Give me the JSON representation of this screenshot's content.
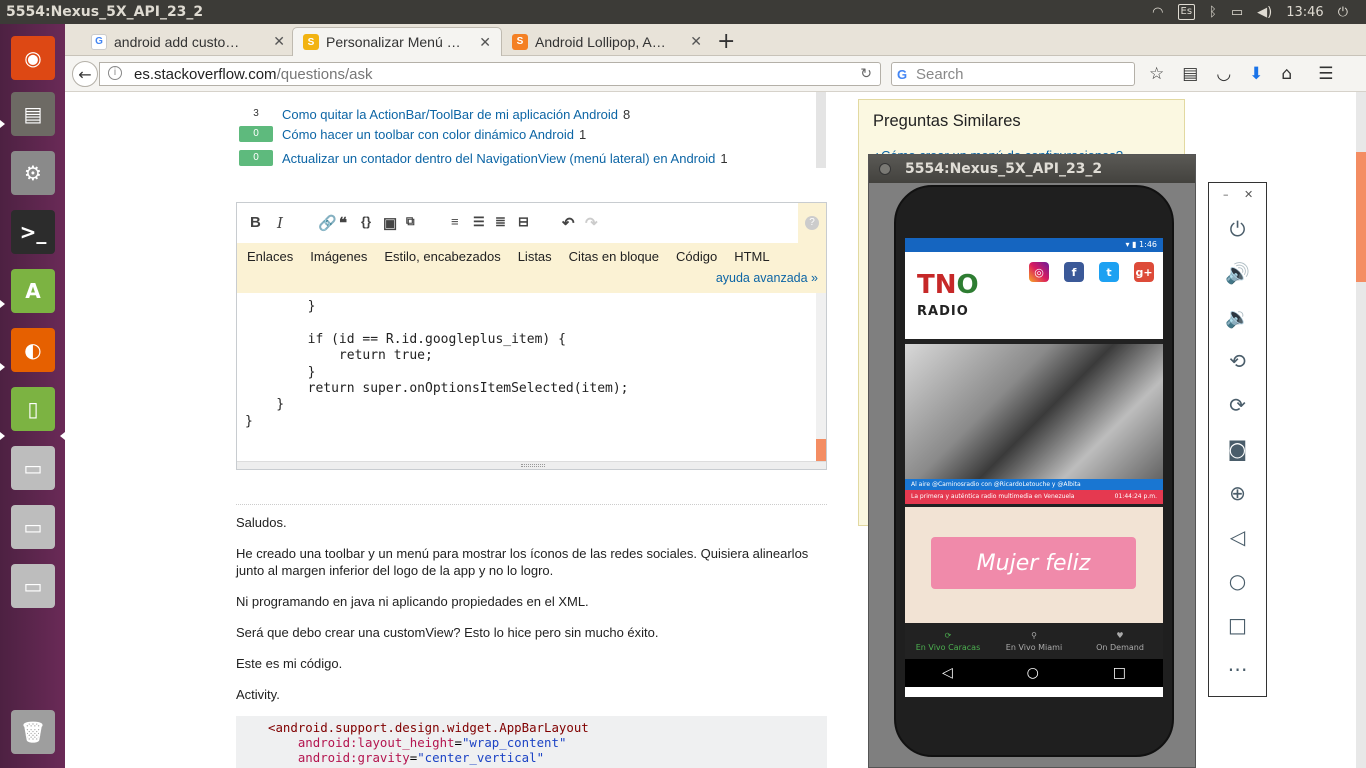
{
  "os": {
    "window_title": "5554:Nexus_5X_API_23_2",
    "keyboard": "Es",
    "time": "13:46"
  },
  "launcher": {
    "items": [
      {
        "name": "ubuntu-dash-icon",
        "color": "#dd4814",
        "glyph": "◉"
      },
      {
        "name": "files-icon",
        "color": "#6d6a64",
        "glyph": "▤"
      },
      {
        "name": "settings-icon",
        "color": "#8a8a8a",
        "glyph": "⚙"
      },
      {
        "name": "terminal-icon",
        "color": "#2c2c2c",
        "glyph": ">_"
      },
      {
        "name": "android-studio-icon",
        "color": "#7cb342",
        "glyph": "A"
      },
      {
        "name": "firefox-icon",
        "color": "#e66000",
        "glyph": "◐"
      },
      {
        "name": "emulator-icon",
        "color": "#7cb342",
        "glyph": "▯"
      },
      {
        "name": "disk-icon",
        "color": "#bdbdbd",
        "glyph": "▭"
      },
      {
        "name": "disk-icon",
        "color": "#bdbdbd",
        "glyph": "▭"
      },
      {
        "name": "disk-icon",
        "color": "#bdbdbd",
        "glyph": "▭"
      },
      {
        "name": "trash-icon",
        "color": "#9e9e9e",
        "glyph": "🗑"
      }
    ]
  },
  "browser": {
    "tabs": [
      {
        "label": "android add custo…",
        "fav": "G",
        "fav_color": "#4285f4"
      },
      {
        "label": "Personalizar Menú …",
        "fav": "S",
        "fav_color": "#f2b311"
      },
      {
        "label": "Android Lollipop, A…",
        "fav": "S",
        "fav_color": "#f48024"
      }
    ],
    "url_host": "es.stackoverflow.com",
    "url_path": "/questions/ask",
    "search_placeholder": "Search"
  },
  "related": [
    {
      "votes": "3",
      "title": "Como quitar la ActionBar/ToolBar de mi aplicación Android",
      "count": "8",
      "accepted": false
    },
    {
      "votes": "0",
      "title": "Cómo hacer un toolbar con color dinámico Android",
      "count": "1",
      "accepted": true
    },
    {
      "votes": "0",
      "title": "Actualizar un contador dentro del NavigationView (menú lateral) en Android",
      "count": "1",
      "accepted": true
    }
  ],
  "editor": {
    "hints": [
      "Enlaces",
      "Imágenes",
      "Estilo, encabezados",
      "Listas",
      "Citas en bloque",
      "Código",
      "HTML"
    ],
    "advanced": "ayuda avanzada »",
    "code": "        }\n\n        if (id == R.id.googleplus_item) {\n            return true;\n        }\n        return super.onOptionsItemSelected(item);\n    }\n}"
  },
  "post": {
    "p1": "Saludos.",
    "p2": "He creado una toolbar y un menú para mostrar los íconos de las redes sociales. Quisiera alinearlos junto al margen inferior del logo de la app y no lo logro.",
    "p3": "Ni programando en java ni aplicando propiedades en el XML.",
    "p4": "Será que debo crear una customView? Esto lo hice pero sin mucho éxito.",
    "p5": "Este es mi código.",
    "p6": "Activity.",
    "xml_tag": "<android.support.design.widget.AppBarLayout",
    "xml_a1": "android:layout_height",
    "xml_v1": "\"wrap_content\"",
    "xml_a2": "android:gravity",
    "xml_v2": "\"center_vertical\""
  },
  "sidebar": {
    "title": "Preguntas Similares",
    "first_q": "¿Cómo crear un menú de configuraciones?"
  },
  "emulator": {
    "title": "5554:Nexus_5X_API_23_2",
    "phone_time": "1:46",
    "logo": "TN",
    "logo_o": "O",
    "logo_sub": "RADIO",
    "banner1": "Al aire @Caminosradio con @RicardoLetouche y @Albita",
    "banner2": "La primera y auténtica radio multimedia en Venezuela",
    "banner_time": "01:44:24 p.m.",
    "promo": "Mujer feliz",
    "tabs": [
      "En Vivo Caracas",
      "En Vivo Miami",
      "On Demand"
    ]
  }
}
